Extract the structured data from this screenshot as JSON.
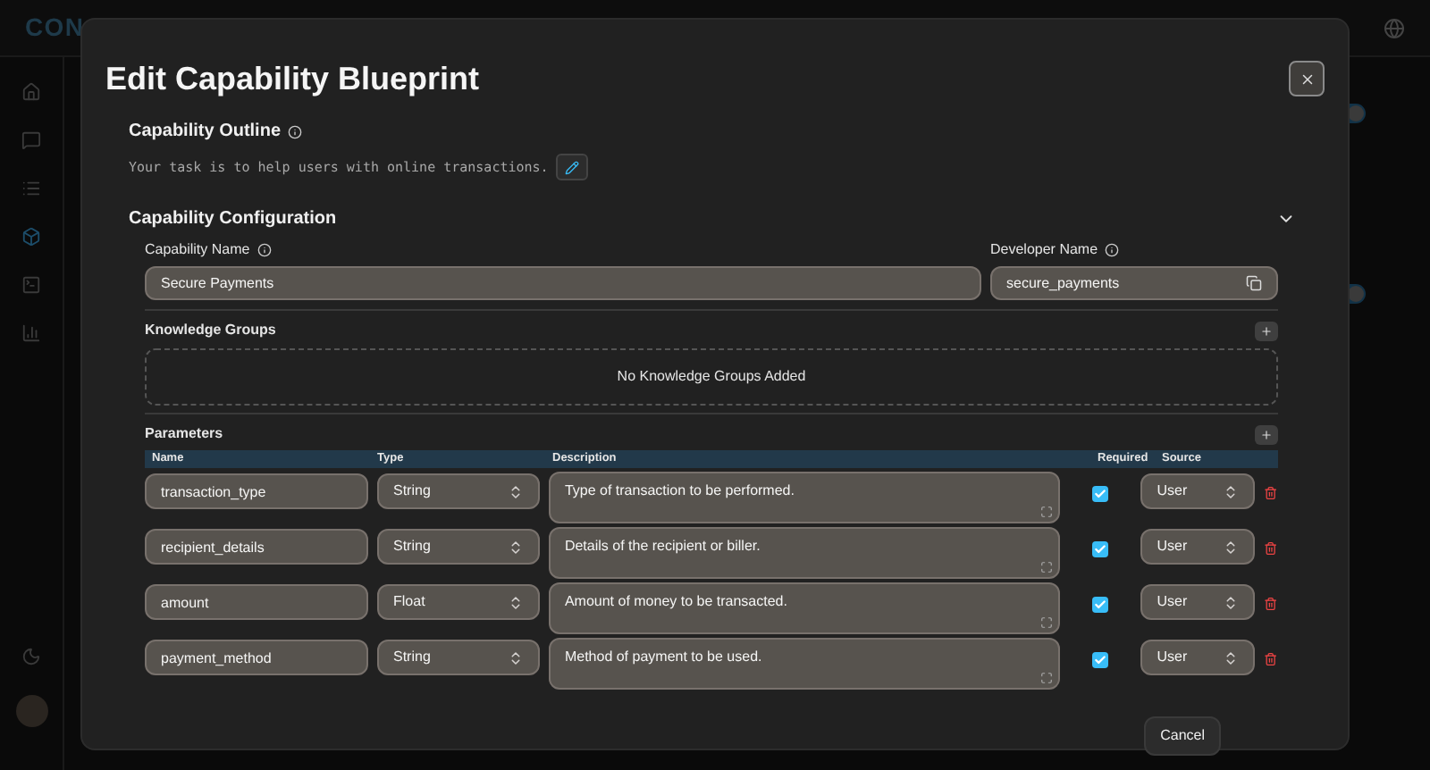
{
  "app": {
    "logo": "CON",
    "background_toggles": [
      {
        "on": true
      },
      {
        "on": true
      }
    ]
  },
  "dialog": {
    "title": "Edit Capability Blueprint",
    "outline": {
      "label": "Capability Outline",
      "text": "Your task is to help users with online transactions."
    },
    "configuration": {
      "label": "Capability Configuration",
      "expanded": true,
      "capability_name": {
        "label": "Capability Name",
        "value": "Secure Payments"
      },
      "developer_name": {
        "label": "Developer Name",
        "value": "secure_payments"
      },
      "knowledge_groups": {
        "label": "Knowledge Groups",
        "empty_text": "No Knowledge Groups Added"
      },
      "parameters": {
        "label": "Parameters",
        "columns": [
          "Name",
          "Type",
          "Description",
          "Required",
          "Source"
        ],
        "rows": [
          {
            "name": "transaction_type",
            "type": "String",
            "description": "Type of transaction to be performed.",
            "required": true,
            "source": "User"
          },
          {
            "name": "recipient_details",
            "type": "String",
            "description": "Details of the recipient or biller.",
            "required": true,
            "source": "User"
          },
          {
            "name": "amount",
            "type": "Float",
            "description": "Amount of money to be transacted.",
            "required": true,
            "source": "User"
          },
          {
            "name": "payment_method",
            "type": "String",
            "description": "Method of payment to be used.",
            "required": true,
            "source": "User"
          }
        ]
      }
    },
    "buttons": [
      "Cancel"
    ]
  }
}
